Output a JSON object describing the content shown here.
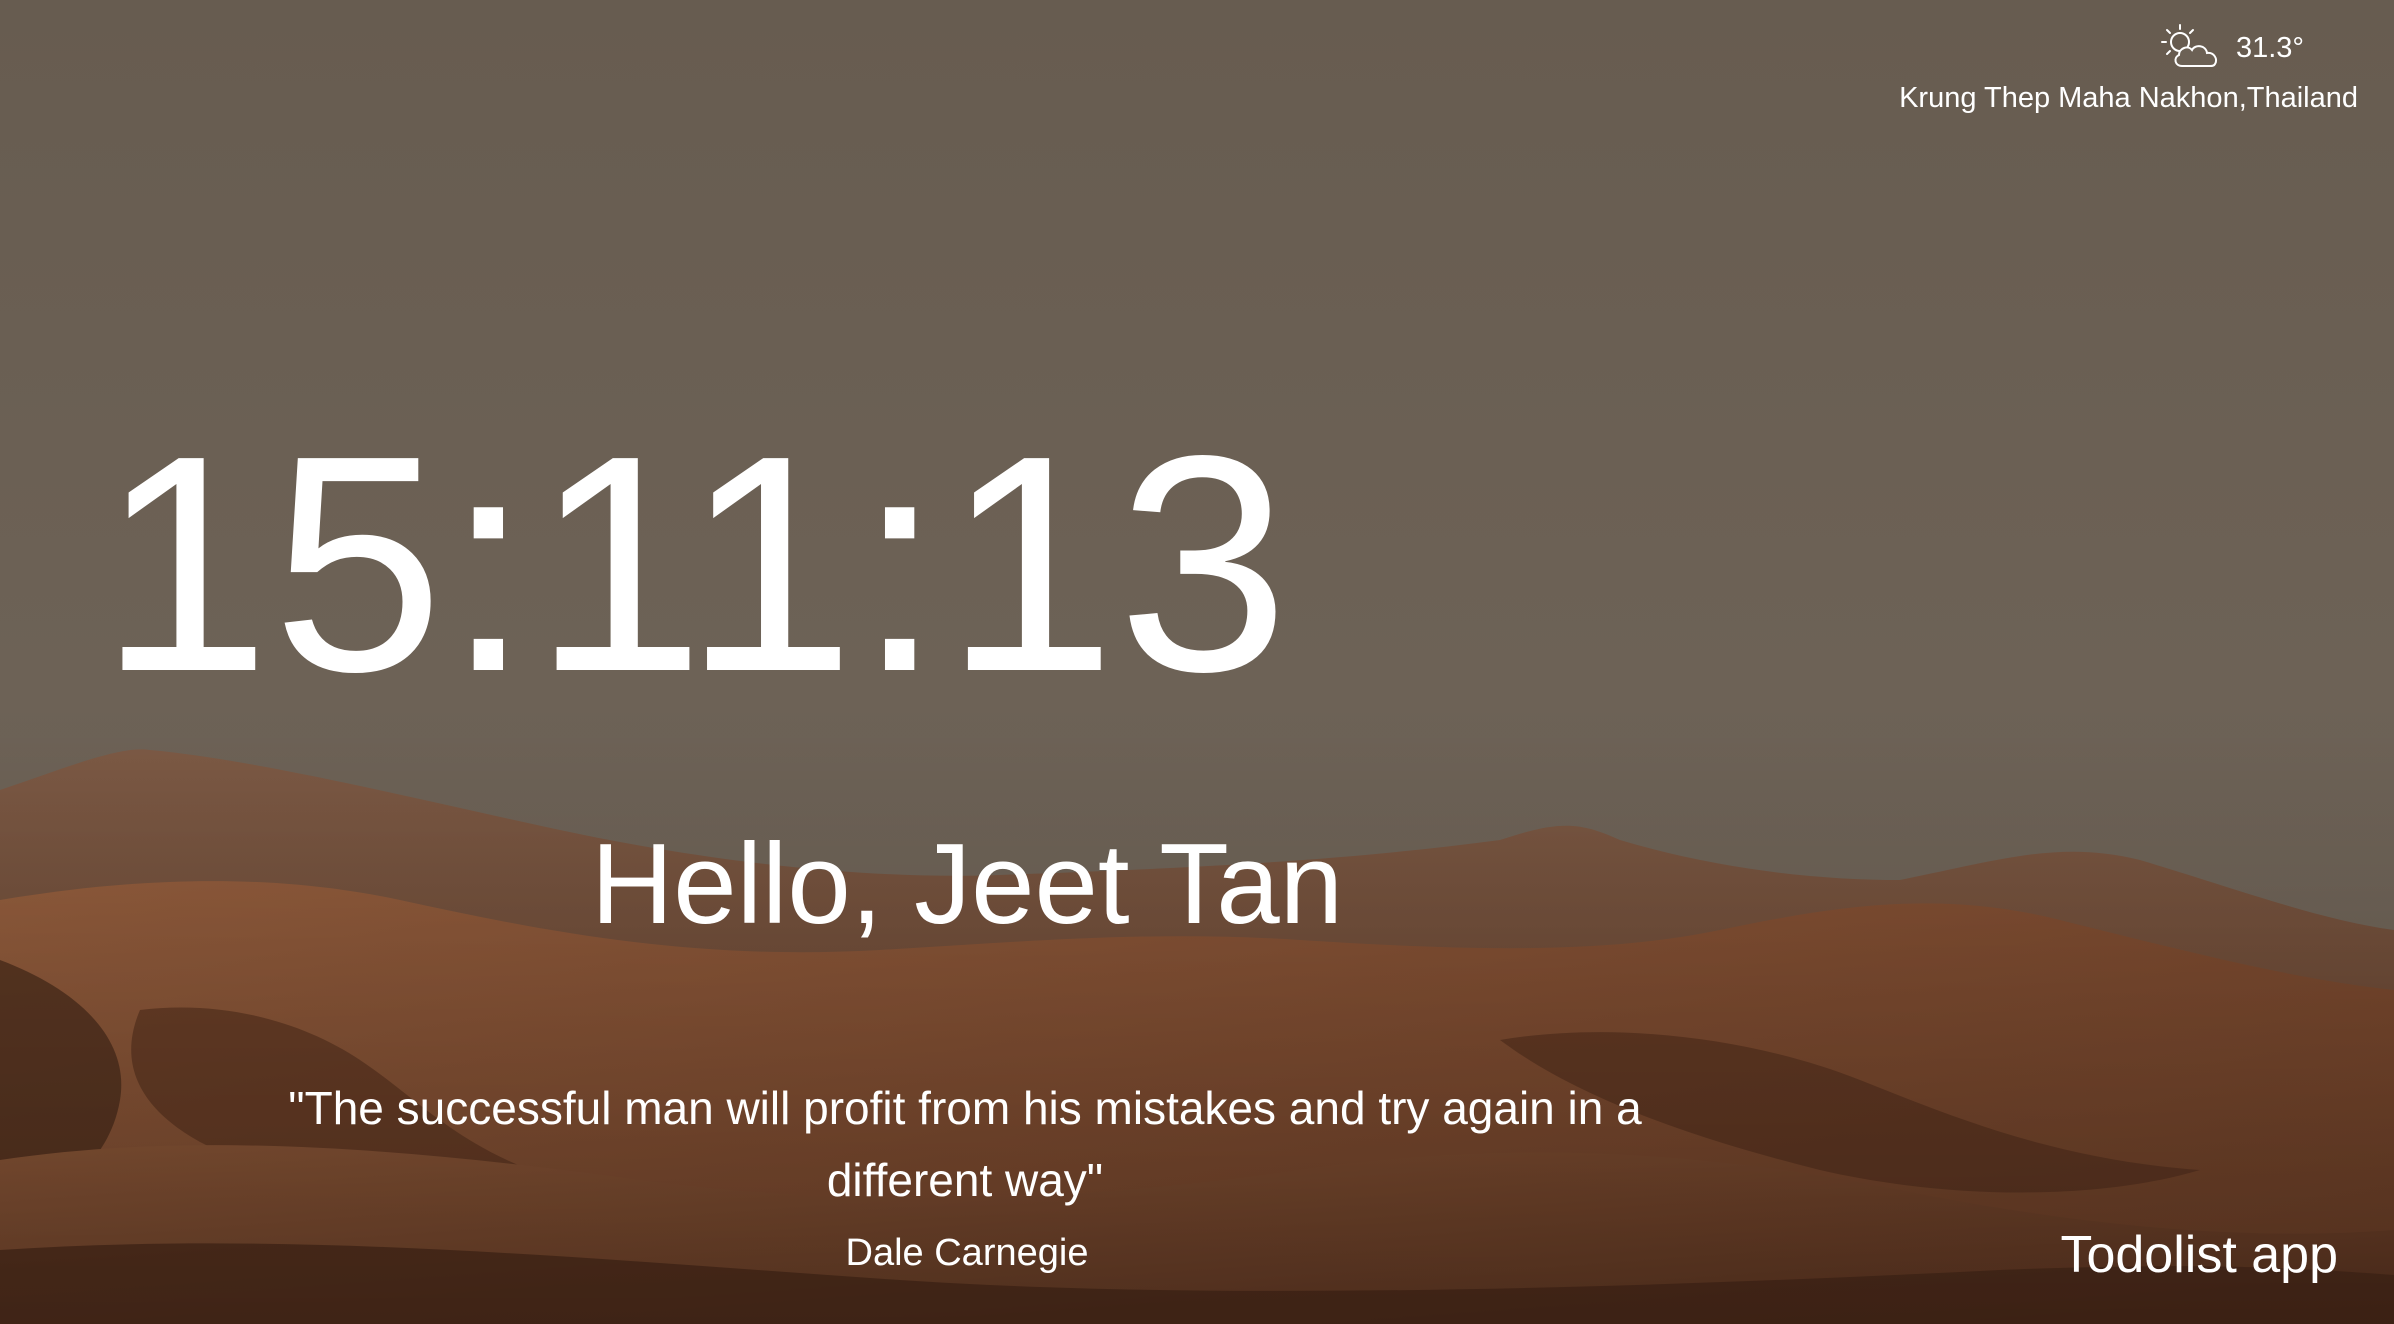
{
  "weather": {
    "icon": "partly-sunny-icon",
    "temperature": "31.3°",
    "location": "Krung Thep Maha Nakhon,Thailand"
  },
  "clock": {
    "time": "15:11:13"
  },
  "greeting": {
    "text": "Hello, Jeet Tan"
  },
  "quote": {
    "text": "\"The successful man will profit from his mistakes and try again in a different way\"",
    "author": "Dale Carnegie"
  },
  "links": {
    "todo_label": "Todolist app"
  },
  "colors": {
    "sky": "#6b6055",
    "dune_light": "#8e5a3a",
    "dune_dark": "#4a2c1c",
    "text": "#ffffff"
  }
}
